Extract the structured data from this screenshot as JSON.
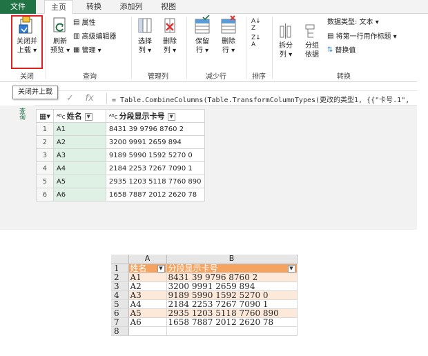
{
  "ribbon": {
    "tabs": [
      "文件",
      "主页",
      "转换",
      "添加列",
      "视图"
    ],
    "active_tab": "主页",
    "groups": {
      "close": {
        "label": "关闭",
        "close_load": "关闭并\n上载",
        "close_load_line1": "关闭并",
        "close_load_line2": "上载 ▾"
      },
      "query": {
        "label": "查询",
        "refresh_line1": "刷新",
        "refresh_line2": "预览 ▾",
        "properties": "属性",
        "advanced_editor": "高级编辑器",
        "manage": "管理 ▾"
      },
      "manage_columns": {
        "label": "管理列",
        "choose_line1": "选择",
        "choose_line2": "列 ▾",
        "remove_line1": "删除",
        "remove_line2": "列 ▾"
      },
      "reduce_rows": {
        "label": "减少行",
        "keep_line1": "保留",
        "keep_line2": "行 ▾",
        "remove_line1": "删除",
        "remove_line2": "行 ▾"
      },
      "sort": {
        "label": "排序"
      },
      "transform": {
        "label": "转换",
        "split_line1": "拆分",
        "split_line2": "列 ▾",
        "group_line1": "分组",
        "group_line2": "依据",
        "data_type": "数据类型: 文本 ▾",
        "first_row_header": "将第一行用作标题 ▾",
        "replace_values": "替换值"
      }
    },
    "tooltip": "关闭并上载"
  },
  "formula_bar": {
    "check_icon": "✓",
    "fx_icon": "fx",
    "formula": "= Table.CombineColumns(Table.TransformColumnTypes(更改的类型1, {{\"卡号.1\","
  },
  "queries_pane": {
    "label": "查询"
  },
  "preview_table": {
    "columns": [
      "姓名",
      "分段显示卡号"
    ],
    "type_icon": "A͟B",
    "rows": [
      {
        "n": "1",
        "name": "A1",
        "card": "8431 39 9796 8760 2"
      },
      {
        "n": "2",
        "name": "A2",
        "card": "3200 9991 2659 894"
      },
      {
        "n": "3",
        "name": "A3",
        "card": "9189 5990 1592 5270 0"
      },
      {
        "n": "4",
        "name": "A4",
        "card": "2184 2253 7267 7090 1"
      },
      {
        "n": "5",
        "name": "A5",
        "card": "2935 1203 5118 7760 890"
      },
      {
        "n": "6",
        "name": "A6",
        "card": "1658 7887 2012 2620 78"
      }
    ]
  },
  "excel_sheet": {
    "col_headers": [
      "A",
      "B"
    ],
    "row_numbers": [
      "1",
      "2",
      "3",
      "4",
      "5",
      "6",
      "7",
      "8"
    ],
    "header_row": [
      "姓名",
      "分段显示卡号"
    ],
    "rows": [
      [
        "A1",
        "8431  39  9796  8760  2"
      ],
      [
        "A2",
        "3200  9991  2659  894"
      ],
      [
        "A3",
        "9189  5990  1592  5270  0"
      ],
      [
        "A4",
        "2184  2253  7267  7090  1"
      ],
      [
        "A5",
        "2935  1203  5118  7760  890"
      ],
      [
        "A6",
        "1658  7887  2012  2620  78"
      ]
    ],
    "colors": {
      "header": "#f4a460",
      "band": "#fde9d9"
    }
  }
}
